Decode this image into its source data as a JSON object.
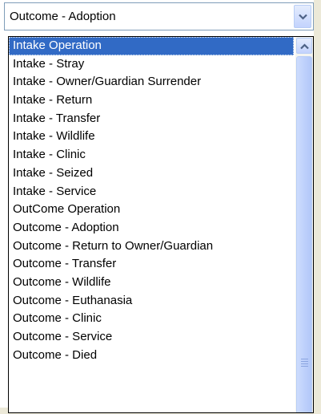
{
  "select": {
    "value": "Outcome - Adoption",
    "arrow_icon": "chevron-down-icon"
  },
  "dropdown": {
    "selected_index": 0,
    "options": [
      "Intake Operation",
      "Intake - Stray",
      "Intake - Owner/Guardian Surrender",
      "Intake - Return",
      "Intake - Transfer",
      "Intake - Wildlife",
      "Intake - Clinic",
      "Intake - Seized",
      "Intake - Service",
      "OutCome Operation",
      "Outcome - Adoption",
      "Outcome - Return to Owner/Guardian",
      "Outcome - Transfer",
      "Outcome - Wildlife",
      "Outcome - Euthanasia",
      "Outcome - Clinic",
      "Outcome - Service",
      "Outcome - Died"
    ],
    "scroll_icon": "chevron-up-icon"
  },
  "colors": {
    "highlight": "#316ac5",
    "border": "#7f9db9",
    "scrollbar_thumb": "#c3d3fd"
  }
}
